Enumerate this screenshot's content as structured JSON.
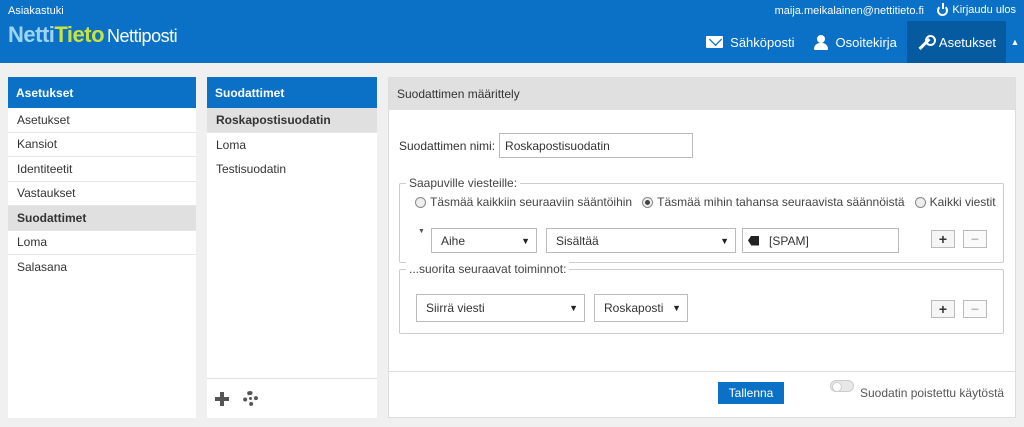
{
  "header": {
    "support_link": "Asiakastuki",
    "logo": {
      "part1": "Netti",
      "part2": "Tieto",
      "part3": "Nettiposti"
    },
    "user_email": "maija.meikalainen@nettitieto.fi",
    "logout_label": "Kirjaudu ulos",
    "nav": {
      "mail_label": "Sähköposti",
      "contacts_label": "Osoitekirja",
      "settings_label": "Asetukset"
    }
  },
  "settings_panel": {
    "title": "Asetukset",
    "items": [
      {
        "label": "Asetukset"
      },
      {
        "label": "Kansiot"
      },
      {
        "label": "Identiteetit"
      },
      {
        "label": "Vastaukset"
      },
      {
        "label": "Suodattimet"
      },
      {
        "label": "Loma"
      },
      {
        "label": "Salasana"
      }
    ],
    "selected": "Suodattimet"
  },
  "filters_panel": {
    "title": "Suodattimet",
    "items": [
      {
        "label": "Roskapostisuodatin"
      },
      {
        "label": "Loma"
      },
      {
        "label": "Testisuodatin"
      }
    ],
    "selected": "Roskapostisuodatin"
  },
  "filter_form": {
    "title": "Suodattimen määrittely",
    "name_label": "Suodattimen nimi:",
    "name_value": "Roskapostisuodatin",
    "incoming_legend": "Saapuville viesteille:",
    "radios": [
      {
        "label": "Täsmää kaikkiin seuraaviin sääntöihin",
        "checked": false
      },
      {
        "label": "Täsmää mihin tahansa seuraavista säännöistä",
        "checked": true
      },
      {
        "label": "Kaikki viestit",
        "checked": false
      }
    ],
    "rule": {
      "field": "Aihe",
      "operator": "Sisältää",
      "value": "[SPAM]"
    },
    "actions_legend": "...suorita seuraavat toiminnot:",
    "action": {
      "type": "Siirrä viesti",
      "target": "Roskaposti"
    },
    "add_label": "+",
    "remove_label": "−",
    "save_label": "Tallenna",
    "disabled_label": "Suodatin poistettu käytöstä",
    "filter_disabled": false
  }
}
